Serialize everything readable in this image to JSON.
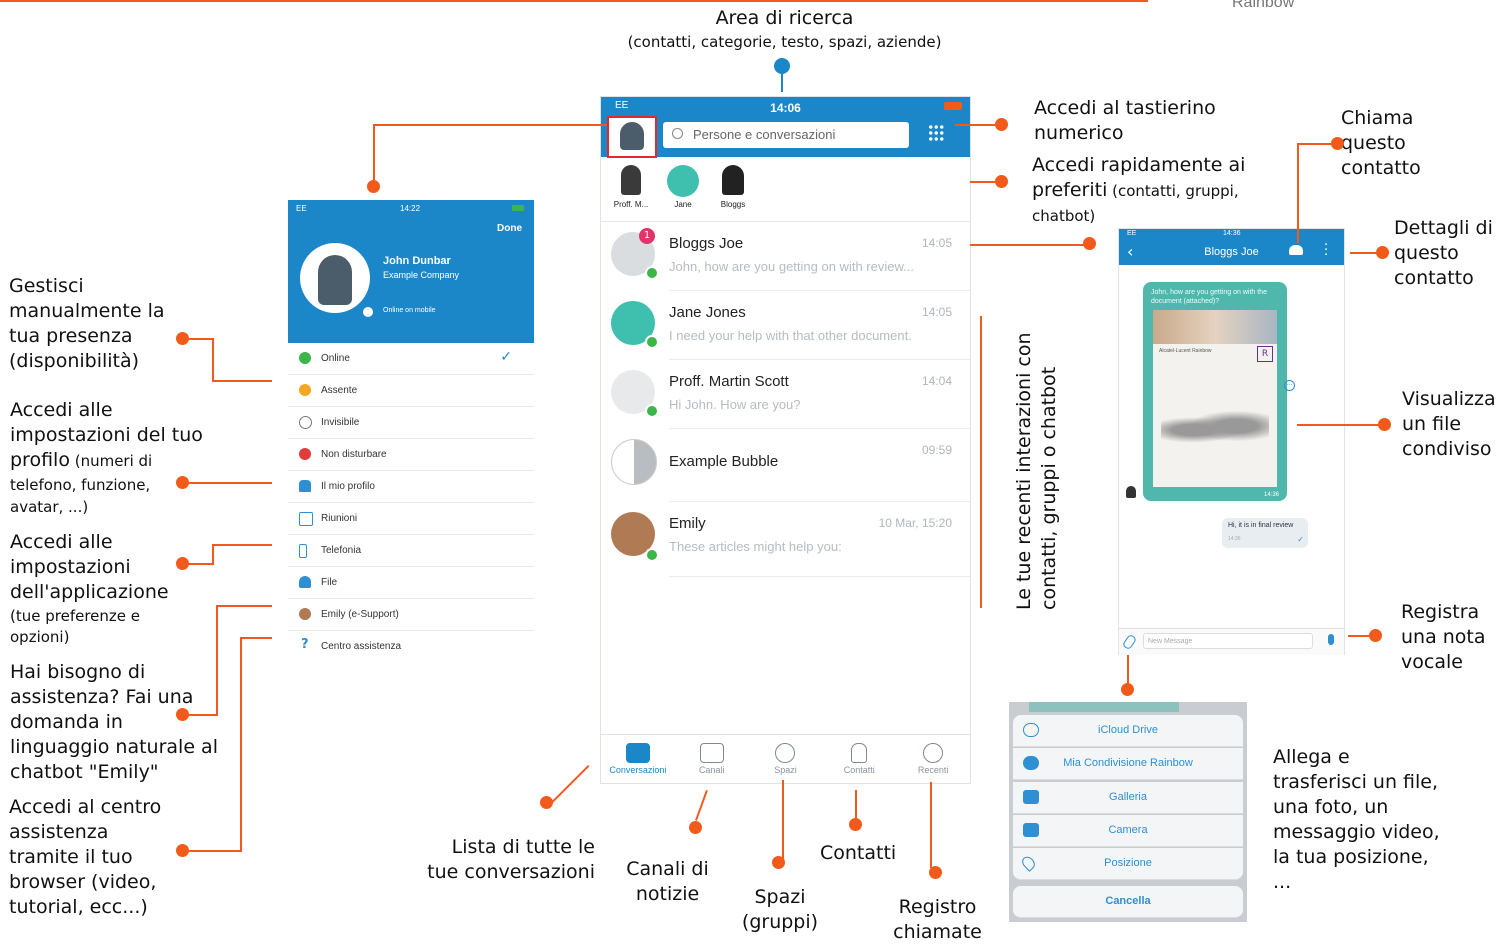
{
  "brand": "Rainbow",
  "colors": {
    "accent": "#f25a1b",
    "header_blue": "#1b87c9",
    "presence_green": "#3cb54a",
    "away_orange": "#f5a623",
    "dnd_red": "#e03c3c",
    "badge_pink": "#e2336b"
  },
  "annotations": {
    "search_title": "Area di ricerca",
    "search_sub": "(contatti, categorie, testo, spazi, aziende)",
    "dialpad": [
      "Accedi al tastierino",
      "numerico"
    ],
    "favorites_line1": "Accedi rapidamente ai",
    "favorites_line2_big": "preferiti",
    "favorites_line2_small": " (contatti, gruppi,",
    "favorites_line3": "chatbot)",
    "call": [
      "Chiama",
      "questo",
      "contatto"
    ],
    "details": [
      "Dettagli di",
      "questo",
      "contatto"
    ],
    "view_file": [
      "Visualizza",
      "un file",
      "condiviso"
    ],
    "voice_note": [
      "Registra",
      "una nota",
      "vocale"
    ],
    "attach": [
      "Allega e",
      "trasferisci un file,",
      "una foto, un",
      "messaggio video,",
      "la tua posizione,",
      "..."
    ],
    "recent_1": "Le  tue recenti interazioni con",
    "recent_2": "contatti, gruppi o chatbot",
    "presence": [
      "Gestisci",
      "manualmente la",
      "tua presenza",
      "(disponibilità)"
    ],
    "profile_1": "Accedi alle",
    "profile_2": "impostazioni del tuo",
    "profile_3": "profilo",
    "profile_3_small": " (numeri di",
    "profile_4": "telefono, funzione,",
    "profile_5": "avatar, ...)",
    "app_settings": [
      "Accedi alle",
      "impostazioni",
      "dell'applicazione"
    ],
    "app_settings_small": [
      "(tue preferenze e",
      "opzioni)"
    ],
    "chatbot": [
      "Hai bisogno di",
      "assistenza? Fai una",
      "domanda in",
      "linguaggio naturale al",
      "chatbot \"Emily\""
    ],
    "help_center": [
      "Accedi al centro",
      "assistenza",
      "tramite il tuo",
      "browser (video,",
      "tutorial, ecc...)"
    ],
    "conv_list": [
      "Lista di tutte le",
      "tue conversazioni"
    ],
    "channels": [
      "Canali di",
      "notizie"
    ],
    "spaces": [
      "Spazi",
      "(gruppi)"
    ],
    "contacts": "Contatti",
    "call_log": [
      "Registro",
      "chiamate"
    ]
  },
  "main_phone": {
    "time": "14:06",
    "carrier": "EE",
    "search_placeholder": "Persone e conversazioni",
    "favorites": [
      {
        "label": "Proff. M..."
      },
      {
        "label": "Jane"
      },
      {
        "label": "Bloggs"
      }
    ],
    "conversations": [
      {
        "name": "Bloggs Joe",
        "message": "John, how are you getting on with review...",
        "time": "14:05",
        "badge": "1"
      },
      {
        "name": "Jane Jones",
        "message": "I need your help with that other document.",
        "time": "14:05"
      },
      {
        "name": "Proff. Martin Scott",
        "message": "Hi John. How are you?",
        "time": "14:04"
      },
      {
        "name": "Example Bubble",
        "message": "",
        "time": "09:59"
      },
      {
        "name": "Emily",
        "message": "These articles might help you:",
        "time": "10 Mar, 15:20"
      }
    ],
    "tabs": [
      "Conversazioni",
      "Canali",
      "Spazi",
      "Contatti",
      "Recenti"
    ]
  },
  "profile_phone": {
    "time": "14:22",
    "carrier": "EE",
    "done": "Done",
    "name": "John Dunbar",
    "company": "Example Company",
    "presence_note": "Online on mobile",
    "items": [
      "Online",
      "Assente",
      "Invisibile",
      "Non disturbare",
      "Il mio profilo",
      "Riunioni",
      "Telefonia",
      "File",
      "Emily (e-Support)",
      "Centro assistenza"
    ]
  },
  "chat_phone": {
    "time": "14:36",
    "carrier": "EE",
    "title": "Bloggs Joe",
    "incoming": "John, how are you getting on with the document (attached)?",
    "doc_title": "Alcatel-Lucent Rainbow",
    "doc_logo_letter": "R",
    "incoming_time": "14:36",
    "reply": "Hi, it is in final review",
    "reply_time": "14:36",
    "input_placeholder": "New Message"
  },
  "share_sheet": {
    "options": [
      "iCloud Drive",
      "Mia Condivisione Rainbow",
      "Galleria",
      "Camera",
      "Posizione"
    ],
    "cancel": "Cancella"
  }
}
